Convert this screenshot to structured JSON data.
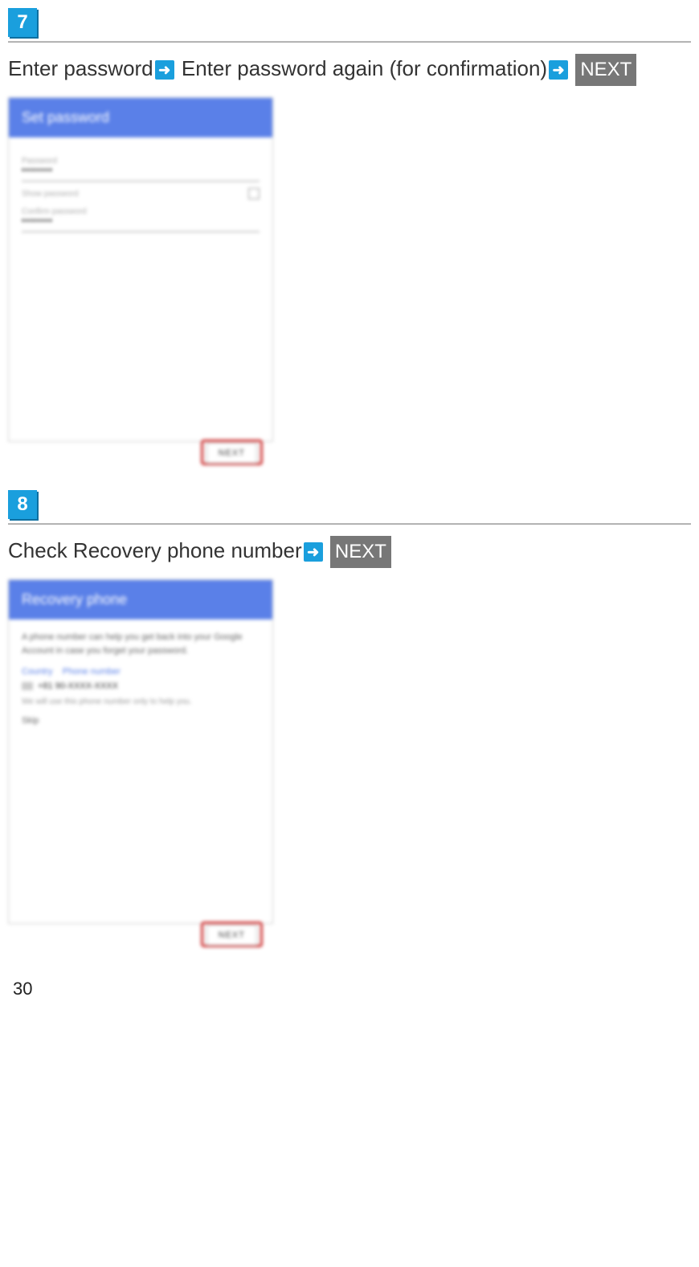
{
  "step7": {
    "number": "7",
    "instruction_part1": "Enter password",
    "instruction_part2": "Enter password again (for confirmation)",
    "next_label": "NEXT",
    "screenshot": {
      "title": "Set password",
      "password_label": "Password",
      "password_value": "••••••••",
      "checkbox_label": "Show password",
      "confirm_label": "Confirm password",
      "confirm_value": "••••••••",
      "button": "NEXT"
    }
  },
  "step8": {
    "number": "8",
    "instruction_part1": "Check Recovery phone number",
    "next_label": "NEXT",
    "screenshot": {
      "title": "Recovery phone",
      "body": "A phone number can help you get back into your Google Account in case you forget your password.",
      "country_label": "Country",
      "phone_label": "Phone number",
      "phone_value": "+81 90-XXXX-XXXX",
      "note": "We will use this phone number only to help you.",
      "skip_label": "Skip",
      "button": "NEXT"
    }
  },
  "page_number": "30"
}
